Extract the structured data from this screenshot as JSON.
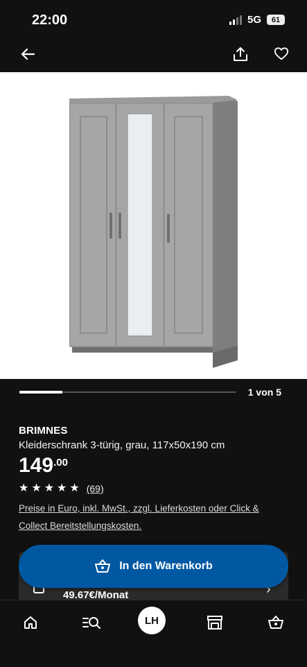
{
  "status_bar": {
    "time": "22:00",
    "network": "5G",
    "battery": "61"
  },
  "nav": {
    "back_icon": "arrow-left-icon",
    "share_icon": "share-icon",
    "favorite_icon": "heart-icon"
  },
  "gallery": {
    "counter": "1 von 5",
    "current_index": 1,
    "total": 5
  },
  "product": {
    "brand": "BRIMNES",
    "description": "Kleiderschrank 3-türig, grau, 117x50x190 cm",
    "price_integer": "149",
    "price_decimal": ".00",
    "rating_stars": 5,
    "rating_count": "(69)",
    "legal_note": "Preise in Euro, inkl. MwSt., zzgl. Lieferkosten oder Click & Collect Bereitstellungskosten."
  },
  "finance": {
    "monthly": "49.67€/Monat"
  },
  "cart": {
    "label": "In den Warenkorb",
    "color": "#0058a3"
  },
  "tabbar": {
    "home_icon": "home-icon",
    "search_icon": "search-list-icon",
    "profile_initials": "LH",
    "store_icon": "store-icon",
    "basket_icon": "basket-icon"
  }
}
